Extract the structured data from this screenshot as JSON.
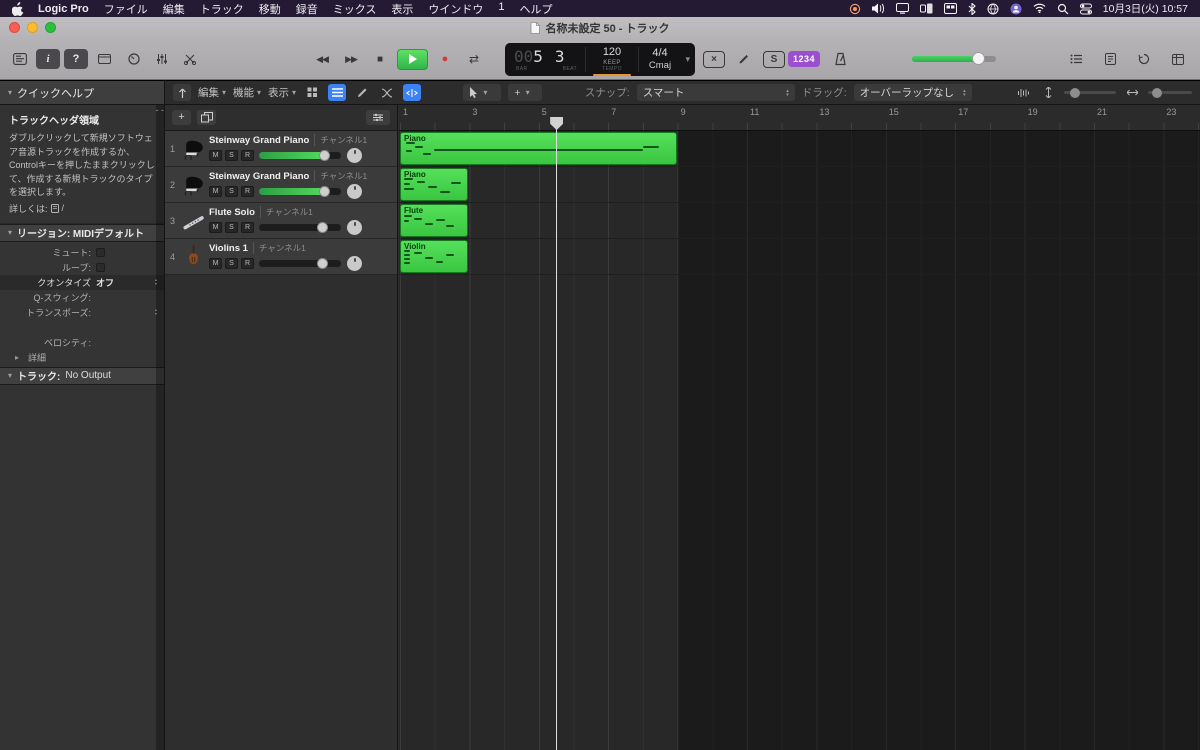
{
  "menu_bar": {
    "app_name": "Logic Pro",
    "menus": [
      "ファイル",
      "編集",
      "トラック",
      "移動",
      "録音",
      "ミックス",
      "表示",
      "ウインドウ",
      "1",
      "ヘルプ"
    ],
    "status_icons": [
      "screen-record",
      "volume",
      "display",
      "stage-manager",
      "windows",
      "bluetooth",
      "globe",
      "user",
      "wifi",
      "search",
      "control-center"
    ],
    "clock": "10月3日(火) 10:57"
  },
  "title_bar": {
    "title": "名称未設定 50 - トラック"
  },
  "toolbar": {
    "lcd": {
      "bar_dim": "00",
      "bar": "5",
      "beat": "3",
      "bar_label": "BAR",
      "beat_label": "BEAT",
      "tempo": "120",
      "tempo_mode": "KEEP",
      "tempo_label": "TEMPO",
      "time_sig": "4/4",
      "key": "Cmaj"
    },
    "count_in_label": "1234",
    "solo_letter": "S",
    "master_volume": 0.78,
    "accent_green": "#3fcf5a",
    "badge_purple": "#9b4fd0",
    "lcd_orange": "#e89435"
  },
  "control_bar": {
    "quick_help_title": "クイックヘルプ",
    "edit_menu": "編集",
    "functions_menu": "機能",
    "view_menu": "表示",
    "snap_label": "スナップ:",
    "snap_value": "スマート",
    "drag_label": "ドラッグ:",
    "drag_value": "オーバーラップなし"
  },
  "inspector": {
    "quick_help": {
      "heading": "トラックヘッダ領域",
      "body": "ダブルクリックして新規ソフトウェア音源トラックを作成するか、Controlキーを押したままクリックして、作成する新規トラックのタイプを選択します。",
      "more_label": "詳しくは:",
      "more_suffix": "/"
    },
    "region_panel": {
      "title": "リージョン: MIDIデフォルト",
      "rows": [
        {
          "label": "ミュート:",
          "control": "checkbox"
        },
        {
          "label": "ループ:",
          "control": "checkbox"
        },
        {
          "label": "クオンタイズ",
          "value": "オフ",
          "control": "stepper",
          "highlight": true
        },
        {
          "label": "Q-スウィング:",
          "value": ""
        },
        {
          "label": "トランスポーズ:",
          "value": "",
          "control": "stepper"
        },
        {
          "label": "",
          "value": "- -"
        },
        {
          "label": "ベロシティ:",
          "value": ""
        },
        {
          "label": "詳細",
          "control": "disclosure"
        }
      ]
    },
    "track_panel": {
      "title": "トラック:",
      "value": "No Output"
    }
  },
  "track_area": {
    "add_track": "+",
    "mute": "M",
    "solo": "S",
    "record": "R"
  },
  "tracks": [
    {
      "num": "1",
      "name": "Steinway Grand Piano",
      "channel": "チャンネル1",
      "icon": "grand-piano",
      "volume": 0.8,
      "volume_filled": true,
      "region": {
        "label": "Piano",
        "start_bar": 1,
        "length_bars": 8,
        "notes": [
          [
            2,
            9,
            3
          ],
          [
            5,
            13,
            3
          ],
          [
            2,
            17,
            2
          ],
          [
            8,
            20,
            3
          ],
          [
            12,
            16,
            76
          ],
          [
            88,
            13,
            6
          ]
        ]
      }
    },
    {
      "num": "2",
      "name": "Steinway Grand Piano",
      "channel": "チャンネル1",
      "icon": "grand-piano",
      "volume": 0.8,
      "volume_filled": true,
      "region": {
        "label": "Piano",
        "start_bar": 1,
        "length_bars": 2,
        "notes": [
          [
            4,
            9,
            14
          ],
          [
            4,
            14,
            10
          ],
          [
            4,
            19,
            16
          ],
          [
            24,
            12,
            12
          ],
          [
            40,
            17,
            14
          ],
          [
            58,
            22,
            16
          ],
          [
            76,
            13,
            14
          ]
        ]
      }
    },
    {
      "num": "3",
      "name": "Flute Solo",
      "channel": "チャンネル1",
      "icon": "flute",
      "volume": 0.78,
      "volume_filled": false,
      "region": {
        "label": "Flute",
        "start_bar": 1,
        "length_bars": 2,
        "notes": [
          [
            4,
            10,
            12
          ],
          [
            4,
            15,
            8
          ],
          [
            20,
            13,
            12
          ],
          [
            36,
            18,
            12
          ],
          [
            52,
            14,
            14
          ],
          [
            68,
            20,
            12
          ]
        ]
      }
    },
    {
      "num": "4",
      "name": "Violins 1",
      "channel": "チャンネル1",
      "icon": "violin",
      "volume": 0.78,
      "volume_filled": false,
      "region": {
        "label": "Violin",
        "start_bar": 1,
        "length_bars": 2,
        "notes": [
          [
            4,
            9,
            10
          ],
          [
            4,
            13,
            10
          ],
          [
            4,
            17,
            10
          ],
          [
            4,
            21,
            10
          ],
          [
            20,
            11,
            12
          ],
          [
            36,
            16,
            12
          ],
          [
            52,
            20,
            12
          ],
          [
            68,
            13,
            12
          ]
        ]
      }
    }
  ],
  "timeline": {
    "bar_numbers": [
      1,
      3,
      5,
      7,
      9,
      11,
      13,
      15,
      17,
      19,
      21,
      23
    ],
    "playhead_bar": 5.5,
    "project_end_bar": 9,
    "region_green": "#44d44c"
  }
}
